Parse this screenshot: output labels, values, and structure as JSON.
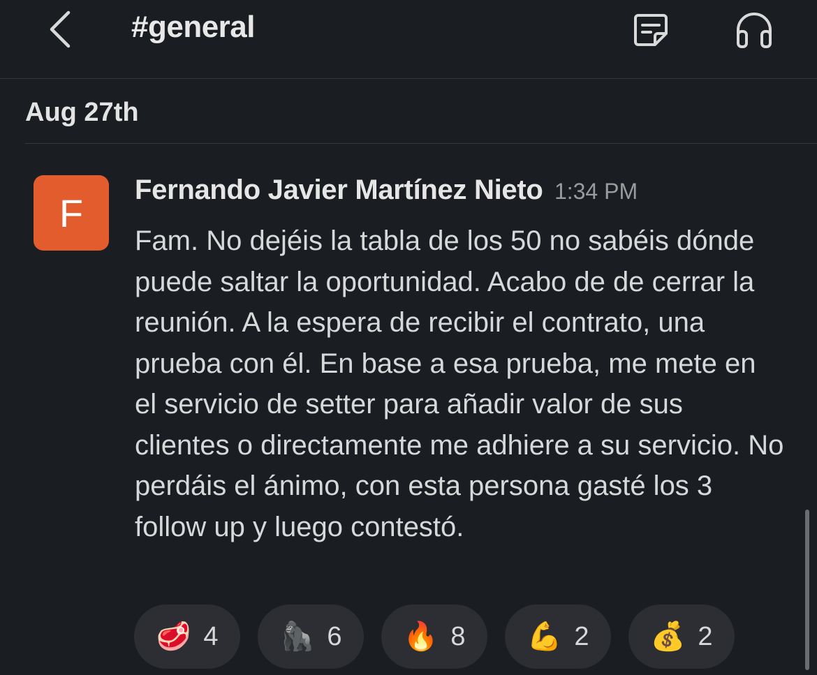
{
  "header": {
    "channel": "#general",
    "back_icon": "chevron-left-icon",
    "canvas_icon": "canvas-icon",
    "huddle_icon": "headphones-icon"
  },
  "date_divider": "Aug 27th",
  "message": {
    "avatar_letter": "F",
    "avatar_color": "#e35c2d",
    "author": "Fernando Javier Martínez Nieto",
    "time": "1:34 PM",
    "text": "Fam. No dejéis la tabla de los 50 no sabéis dónde puede saltar la oportunidad. Acabo de de cerrar la reunión. A la espera de recibir el contrato, una prueba con él. En base a esa prueba, me mete en el servicio de setter para añadir valor de sus clientes o directamente me adhiere a su servicio. No perdáis el ánimo, con esta persona gasté los 3 follow up y luego contestó.",
    "reactions": [
      {
        "emoji": "🥩",
        "name": "steak-emoji",
        "count": "4"
      },
      {
        "emoji": "🦍",
        "name": "gorilla-emoji",
        "count": "6"
      },
      {
        "emoji": "🔥",
        "name": "fire-emoji",
        "count": "8"
      },
      {
        "emoji": "💪",
        "name": "flexed-biceps-emoji",
        "count": "2"
      },
      {
        "emoji": "💰",
        "name": "money-bag-emoji",
        "count": "2"
      }
    ]
  },
  "colors": {
    "background": "#1a1d21",
    "reaction_pill": "#2c2e33",
    "divider": "#35373b"
  }
}
